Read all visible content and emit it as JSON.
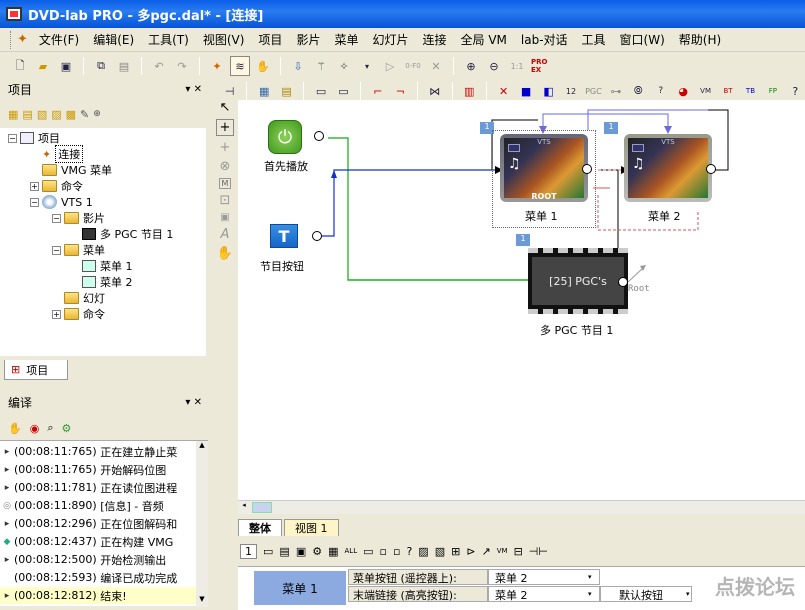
{
  "window": {
    "title": "DVD-lab PRO - 多pgc.dal* - [连接]"
  },
  "menu": [
    "文件(F)",
    "编辑(E)",
    "工具(T)",
    "视图(V)",
    "项目",
    "影片",
    "菜单",
    "幻灯片",
    "连接",
    "全局 VM",
    "lab-对话",
    "工具",
    "窗口(W)",
    "帮助(H)"
  ],
  "project_panel": {
    "title": "项目",
    "controls": "▾ ✕",
    "tree": [
      {
        "label": "项目",
        "depth": 0
      },
      {
        "label": "连接",
        "depth": 1
      },
      {
        "label": "VMG 菜单",
        "depth": 1
      },
      {
        "label": "命令",
        "depth": 1
      },
      {
        "label": "VTS 1",
        "depth": 1
      },
      {
        "label": "影片",
        "depth": 2
      },
      {
        "label": "多 PGC 节目 1",
        "depth": 3
      },
      {
        "label": "菜单",
        "depth": 2
      },
      {
        "label": "菜单 1",
        "depth": 3
      },
      {
        "label": "菜单 2",
        "depth": 3
      },
      {
        "label": "幻灯",
        "depth": 2
      },
      {
        "label": "命令",
        "depth": 2
      }
    ],
    "tab": "项目"
  },
  "compile_panel": {
    "title": "编译",
    "controls": "▾ ✕",
    "log": [
      {
        "time": "(00:08:11:765)",
        "text": "正在建立静止菜"
      },
      {
        "time": "(00:08:11:765)",
        "text": "开始解码位图"
      },
      {
        "time": "(00:08:11:781)",
        "text": "正在读位图进程"
      },
      {
        "time": "(00:08:11:890)",
        "text": "[信息] - 音频"
      },
      {
        "time": "(00:08:12:296)",
        "text": "正在位图解码和"
      },
      {
        "time": "(00:08:12:437)",
        "text": "正在构建 VMG"
      },
      {
        "time": "(00:08:12:500)",
        "text": "开始检测输出"
      },
      {
        "time": "(00:08:12:593)",
        "text": "编译已成功完成"
      },
      {
        "time": "(00:08:12:812)",
        "text": "结束!"
      }
    ]
  },
  "canvas": {
    "first_play": "首先播放",
    "title_button": "节目按钮",
    "menu1": {
      "label": "菜单 1",
      "badge": "1",
      "sub": "ROOT",
      "vts": "VTS"
    },
    "menu2": {
      "label": "菜单 2",
      "badge": "1",
      "vts": "VTS"
    },
    "pgc": {
      "label": "多 PGC 节目 1",
      "badge": "1",
      "text": "[25] PGC's",
      "root": "Root"
    }
  },
  "bottom_tabs": [
    "整体",
    "视图 1"
  ],
  "bottom_toolbar_left": "1",
  "properties": {
    "item": "菜单 1",
    "rows": [
      {
        "name": "菜单按钮 (遥控器上):",
        "value": "菜单 2",
        "extra": ""
      },
      {
        "name": "末端链接 (高亮按钮):",
        "value": "菜单 2",
        "extra": "默认按钮"
      }
    ]
  },
  "watermark": "点拨论坛",
  "colors": {
    "title": "#0a5ee8",
    "green_link": "#11aa11",
    "blue_link": "#1133cc",
    "first_play": "#52a823"
  }
}
